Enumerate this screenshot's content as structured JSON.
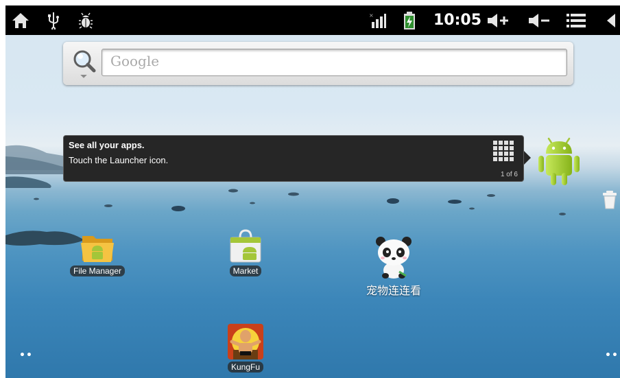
{
  "status_bar": {
    "time": "10:05",
    "left_icons": [
      "home-icon",
      "usb-icon",
      "debug-bug-icon"
    ],
    "right_icons": [
      "signal-icon",
      "battery-charging-icon",
      "volume-up-icon",
      "volume-down-icon",
      "menu-icon",
      "back-icon"
    ]
  },
  "search": {
    "placeholder": "Google"
  },
  "tooltip": {
    "title": "See all your apps.",
    "body": "Touch the Launcher icon.",
    "counter": "1 of 6"
  },
  "apps": [
    {
      "label": "File Manager",
      "icon": "folder-android-icon"
    },
    {
      "label": "Market",
      "icon": "market-bag-icon"
    },
    {
      "label": "宠物连连看",
      "icon": "panda-icon"
    },
    {
      "label": "KungFu",
      "icon": "kungfu-fighter-icon"
    }
  ],
  "colors": {
    "status_bar": "#000000",
    "android_green": "#a4c639",
    "tooltip_bg": "#262626"
  }
}
